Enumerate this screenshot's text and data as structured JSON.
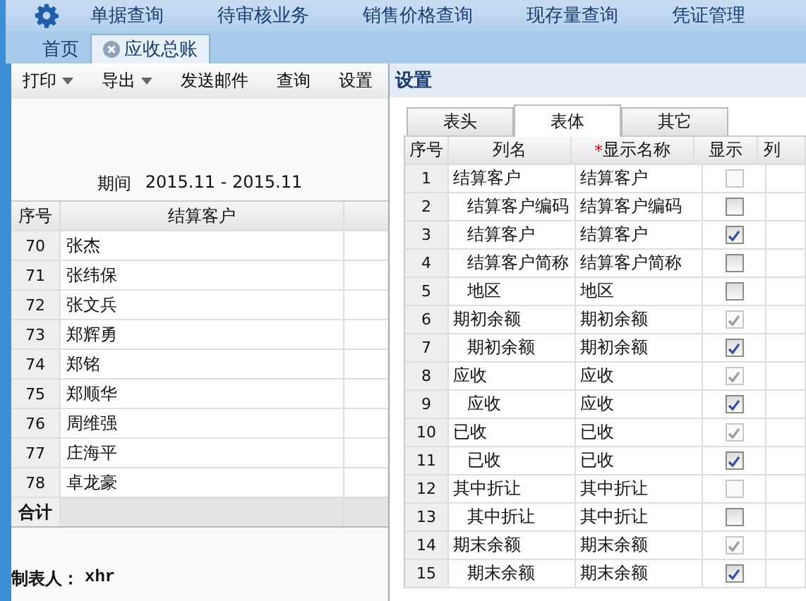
{
  "top_menu": [
    {
      "label": "单据查询"
    },
    {
      "label": "待审核业务"
    },
    {
      "label": "销售价格查询"
    },
    {
      "label": "现存量查询"
    },
    {
      "label": "凭证管理"
    }
  ],
  "page_tabs": [
    {
      "label": "首页",
      "selected": false,
      "closable": false
    },
    {
      "label": "应收总账",
      "selected": true,
      "closable": true
    }
  ],
  "report": {
    "toolbar": [
      {
        "label": "打印",
        "dropdown": true
      },
      {
        "label": "导出",
        "dropdown": true
      },
      {
        "label": "发送邮件",
        "dropdown": false
      },
      {
        "label": "查询",
        "dropdown": false
      },
      {
        "label": "设置",
        "dropdown": false
      }
    ],
    "period_label": "期间",
    "period_value": "2015.11 - 2015.11",
    "columns": [
      "序号",
      "结算客户"
    ],
    "rows": [
      {
        "no": "70",
        "customer": "张杰"
      },
      {
        "no": "71",
        "customer": "张纬保"
      },
      {
        "no": "72",
        "customer": "张文兵"
      },
      {
        "no": "73",
        "customer": "郑辉勇"
      },
      {
        "no": "74",
        "customer": "郑铭"
      },
      {
        "no": "75",
        "customer": "郑顺华"
      },
      {
        "no": "76",
        "customer": "周维强"
      },
      {
        "no": "77",
        "customer": "庄海平"
      },
      {
        "no": "78",
        "customer": "卓龙豪"
      }
    ],
    "total_label": "合计",
    "maker_label": "制表人：",
    "maker": "xhr"
  },
  "settings": {
    "title": "设置",
    "tabs": [
      {
        "label": "表头",
        "selected": false
      },
      {
        "label": "表体",
        "selected": true
      },
      {
        "label": "其它",
        "selected": false
      }
    ],
    "columns": [
      {
        "label": "序号"
      },
      {
        "label": "列名"
      },
      {
        "label": "显示名称",
        "required_mark": "*"
      },
      {
        "label": "显示"
      },
      {
        "label": "列"
      }
    ],
    "rows": [
      {
        "no": "1",
        "name": "结算客户",
        "display": "结算客户",
        "checked": false,
        "disabled": true,
        "children": [
          {
            "no": "2",
            "name": "结算客户编码",
            "display": "结算客户编码",
            "checked": false,
            "disabled": false
          },
          {
            "no": "3",
            "name": "结算客户",
            "display": "结算客户",
            "checked": true,
            "disabled": false
          },
          {
            "no": "4",
            "name": "结算客户简称",
            "display": "结算客户简称",
            "checked": false,
            "disabled": false
          },
          {
            "no": "5",
            "name": "地区",
            "display": "地区",
            "checked": false,
            "disabled": false
          }
        ]
      },
      {
        "no": "6",
        "name": "期初余额",
        "display": "期初余额",
        "checked": true,
        "disabled": true,
        "children": [
          {
            "no": "7",
            "name": "期初余额",
            "display": "期初余额",
            "checked": true,
            "disabled": false
          }
        ]
      },
      {
        "no": "8",
        "name": "应收",
        "display": "应收",
        "checked": true,
        "disabled": true,
        "children": [
          {
            "no": "9",
            "name": "应收",
            "display": "应收",
            "checked": true,
            "disabled": false
          }
        ]
      },
      {
        "no": "10",
        "name": "已收",
        "display": "已收",
        "checked": true,
        "disabled": true,
        "children": [
          {
            "no": "11",
            "name": "已收",
            "display": "已收",
            "checked": true,
            "disabled": false
          }
        ]
      },
      {
        "no": "12",
        "name": "其中折让",
        "display": "其中折让",
        "checked": false,
        "disabled": true,
        "children": [
          {
            "no": "13",
            "name": "其中折让",
            "display": "其中折让",
            "checked": false,
            "disabled": false
          }
        ]
      },
      {
        "no": "14",
        "name": "期末余额",
        "display": "期末余额",
        "checked": true,
        "disabled": true,
        "children": [
          {
            "no": "15",
            "name": "期末余额",
            "display": "期末余额",
            "checked": true,
            "disabled": false
          }
        ]
      }
    ]
  }
}
